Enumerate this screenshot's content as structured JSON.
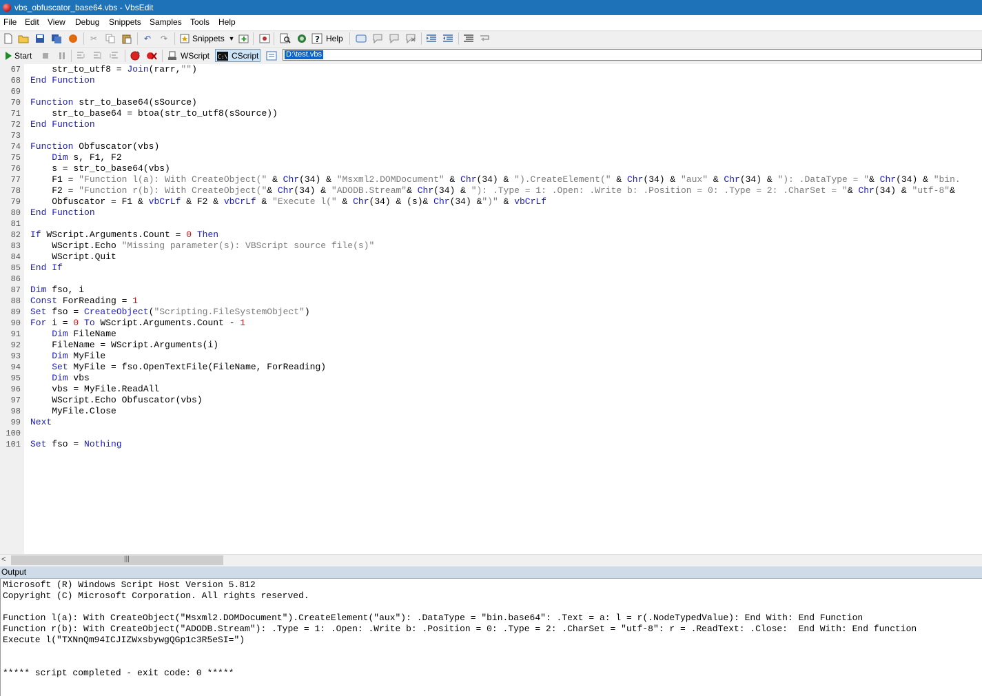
{
  "window": {
    "title": "vbs_obfuscator_base64.vbs - VbsEdit"
  },
  "menu": [
    "File",
    "Edit",
    "View",
    "Debug",
    "Snippets",
    "Samples",
    "Tools",
    "Help"
  ],
  "toolbar1": {
    "snippets_label": "Snippets",
    "help_label": "Help"
  },
  "toolbar2": {
    "start_label": "Start",
    "wscript_label": "WScript",
    "cscript_label": "CScript",
    "cmdline_value": "D:\\test.vbs"
  },
  "editor": {
    "lines": [
      {
        "n": "67",
        "t": [
          [
            "    str_to_utf8 = ",
            ""
          ],
          [
            "Join",
            "fn"
          ],
          [
            "(rarr,",
            ""
          ],
          [
            "\"\"",
            "st"
          ],
          [
            ")",
            ""
          ]
        ]
      },
      {
        "n": "68",
        "t": [
          [
            "End Function",
            "kw"
          ]
        ]
      },
      {
        "n": "69",
        "t": []
      },
      {
        "n": "70",
        "t": [
          [
            "Function",
            "kw"
          ],
          [
            " str_to_base64(sSource)",
            ""
          ]
        ]
      },
      {
        "n": "71",
        "t": [
          [
            "    str_to_base64 = btoa(str_to_utf8(sSource))",
            ""
          ]
        ]
      },
      {
        "n": "72",
        "t": [
          [
            "End Function",
            "kw"
          ]
        ]
      },
      {
        "n": "73",
        "t": []
      },
      {
        "n": "74",
        "t": [
          [
            "Function",
            "kw"
          ],
          [
            " Obfuscator(vbs)",
            ""
          ]
        ]
      },
      {
        "n": "75",
        "t": [
          [
            "    ",
            ""
          ],
          [
            "Dim",
            "kw"
          ],
          [
            " s, F1, F2",
            ""
          ]
        ]
      },
      {
        "n": "76",
        "t": [
          [
            "    s = str_to_base64(vbs)",
            ""
          ]
        ]
      },
      {
        "n": "77",
        "t": [
          [
            "    F1 = ",
            ""
          ],
          [
            "\"Function l(a): With CreateObject(\"",
            "st"
          ],
          [
            " & ",
            ""
          ],
          [
            "Chr",
            "fn"
          ],
          [
            "(34) & ",
            ""
          ],
          [
            "\"Msxml2.DOMDocument\"",
            "st"
          ],
          [
            " & ",
            ""
          ],
          [
            "Chr",
            "fn"
          ],
          [
            "(34) & ",
            ""
          ],
          [
            "\").CreateElement(\"",
            "st"
          ],
          [
            " & ",
            ""
          ],
          [
            "Chr",
            "fn"
          ],
          [
            "(34) & ",
            ""
          ],
          [
            "\"aux\"",
            "st"
          ],
          [
            " & ",
            ""
          ],
          [
            "Chr",
            "fn"
          ],
          [
            "(34) & ",
            ""
          ],
          [
            "\"): .DataType = \"",
            "st"
          ],
          [
            "& ",
            ""
          ],
          [
            "Chr",
            "fn"
          ],
          [
            "(34) & ",
            ""
          ],
          [
            "\"bin.",
            "st"
          ]
        ]
      },
      {
        "n": "78",
        "t": [
          [
            "    F2 = ",
            ""
          ],
          [
            "\"Function r(b): With CreateObject(\"",
            "st"
          ],
          [
            "& ",
            ""
          ],
          [
            "Chr",
            "fn"
          ],
          [
            "(34) & ",
            ""
          ],
          [
            "\"ADODB.Stream\"",
            "st"
          ],
          [
            "& ",
            ""
          ],
          [
            "Chr",
            "fn"
          ],
          [
            "(34) & ",
            ""
          ],
          [
            "\"): .Type = 1: .Open: .Write b: .Position = 0: .Type = 2: .CharSet = \"",
            "st"
          ],
          [
            "& ",
            ""
          ],
          [
            "Chr",
            "fn"
          ],
          [
            "(34) & ",
            ""
          ],
          [
            "\"utf-8\"",
            "st"
          ],
          [
            "&",
            ""
          ]
        ]
      },
      {
        "n": "79",
        "t": [
          [
            "    Obfuscator = F1 & ",
            ""
          ],
          [
            "vbCrLf",
            "fn"
          ],
          [
            " & F2 & ",
            ""
          ],
          [
            "vbCrLf",
            "fn"
          ],
          [
            " & ",
            ""
          ],
          [
            "\"Execute l(\"",
            "st"
          ],
          [
            " & ",
            ""
          ],
          [
            "Chr",
            "fn"
          ],
          [
            "(34) & (s)& ",
            ""
          ],
          [
            "Chr",
            "fn"
          ],
          [
            "(34) &",
            ""
          ],
          [
            "\")\"",
            "st"
          ],
          [
            " & ",
            ""
          ],
          [
            "vbCrLf",
            "fn"
          ]
        ]
      },
      {
        "n": "80",
        "t": [
          [
            "End Function",
            "kw"
          ]
        ]
      },
      {
        "n": "81",
        "t": []
      },
      {
        "n": "82",
        "t": [
          [
            "If",
            "kw"
          ],
          [
            " WScript.Arguments.Count = ",
            ""
          ],
          [
            "0",
            "nm"
          ],
          [
            " ",
            ""
          ],
          [
            "Then",
            "kw"
          ]
        ]
      },
      {
        "n": "83",
        "t": [
          [
            "    WScript.Echo ",
            ""
          ],
          [
            "\"Missing parameter(s): VBScript source file(s)\"",
            "st"
          ]
        ]
      },
      {
        "n": "84",
        "t": [
          [
            "    WScript.Quit",
            ""
          ]
        ]
      },
      {
        "n": "85",
        "t": [
          [
            "End If",
            "kw"
          ]
        ]
      },
      {
        "n": "86",
        "t": []
      },
      {
        "n": "87",
        "t": [
          [
            "Dim",
            "kw"
          ],
          [
            " fso, i",
            ""
          ]
        ]
      },
      {
        "n": "88",
        "t": [
          [
            "Const",
            "kw"
          ],
          [
            " ForReading = ",
            ""
          ],
          [
            "1",
            "nm"
          ]
        ]
      },
      {
        "n": "89",
        "t": [
          [
            "Set",
            "kw"
          ],
          [
            " fso = ",
            ""
          ],
          [
            "CreateObject",
            "fn"
          ],
          [
            "(",
            ""
          ],
          [
            "\"Scripting.FileSystemObject\"",
            "st"
          ],
          [
            ")",
            ""
          ]
        ]
      },
      {
        "n": "90",
        "t": [
          [
            "For",
            "kw"
          ],
          [
            " i = ",
            ""
          ],
          [
            "0",
            "nm"
          ],
          [
            " ",
            ""
          ],
          [
            "To",
            "kw"
          ],
          [
            " WScript.Arguments.Count - ",
            ""
          ],
          [
            "1",
            "nm"
          ]
        ]
      },
      {
        "n": "91",
        "t": [
          [
            "    ",
            ""
          ],
          [
            "Dim",
            "kw"
          ],
          [
            " FileName",
            ""
          ]
        ]
      },
      {
        "n": "92",
        "t": [
          [
            "    FileName = WScript.Arguments(i)",
            ""
          ]
        ]
      },
      {
        "n": "93",
        "t": [
          [
            "    ",
            ""
          ],
          [
            "Dim",
            "kw"
          ],
          [
            " MyFile",
            ""
          ]
        ]
      },
      {
        "n": "94",
        "t": [
          [
            "    ",
            ""
          ],
          [
            "Set",
            "kw"
          ],
          [
            " MyFile = fso.OpenTextFile(FileName, ForReading)",
            ""
          ]
        ]
      },
      {
        "n": "95",
        "t": [
          [
            "    ",
            ""
          ],
          [
            "Dim",
            "kw"
          ],
          [
            " vbs",
            ""
          ]
        ]
      },
      {
        "n": "96",
        "t": [
          [
            "    vbs = MyFile.ReadAll",
            ""
          ]
        ]
      },
      {
        "n": "97",
        "t": [
          [
            "    WScript.Echo Obfuscator(vbs)",
            ""
          ]
        ]
      },
      {
        "n": "98",
        "t": [
          [
            "    MyFile.Close",
            ""
          ]
        ]
      },
      {
        "n": "99",
        "t": [
          [
            "Next",
            "kw"
          ]
        ]
      },
      {
        "n": "100",
        "t": []
      },
      {
        "n": "101",
        "t": [
          [
            "Set",
            "kw"
          ],
          [
            " fso = ",
            ""
          ],
          [
            "Nothing",
            "kw"
          ]
        ]
      }
    ]
  },
  "output": {
    "header": "Output",
    "lines": [
      "Microsoft (R) Windows Script Host Version 5.812",
      "Copyright (C) Microsoft Corporation. All rights reserved.",
      "",
      "Function l(a): With CreateObject(\"Msxml2.DOMDocument\").CreateElement(\"aux\"): .DataType = \"bin.base64\": .Text = a: l = r(.NodeTypedValue): End With: End Function",
      "Function r(b): With CreateObject(\"ADODB.Stream\"): .Type = 1: .Open: .Write b: .Position = 0: .Type = 2: .CharSet = \"utf-8\": r = .ReadText: .Close:  End With: End function",
      "Execute l(\"TXNnQm94ICJIZWxsbywgQGp1c3R5eSI=\")",
      "",
      "",
      "***** script completed - exit code: 0 *****"
    ]
  },
  "colors": {
    "titlebar": "#1e73b8",
    "keyword": "#1a1acc",
    "string": "#7a7a7a",
    "number": "#c81010"
  }
}
